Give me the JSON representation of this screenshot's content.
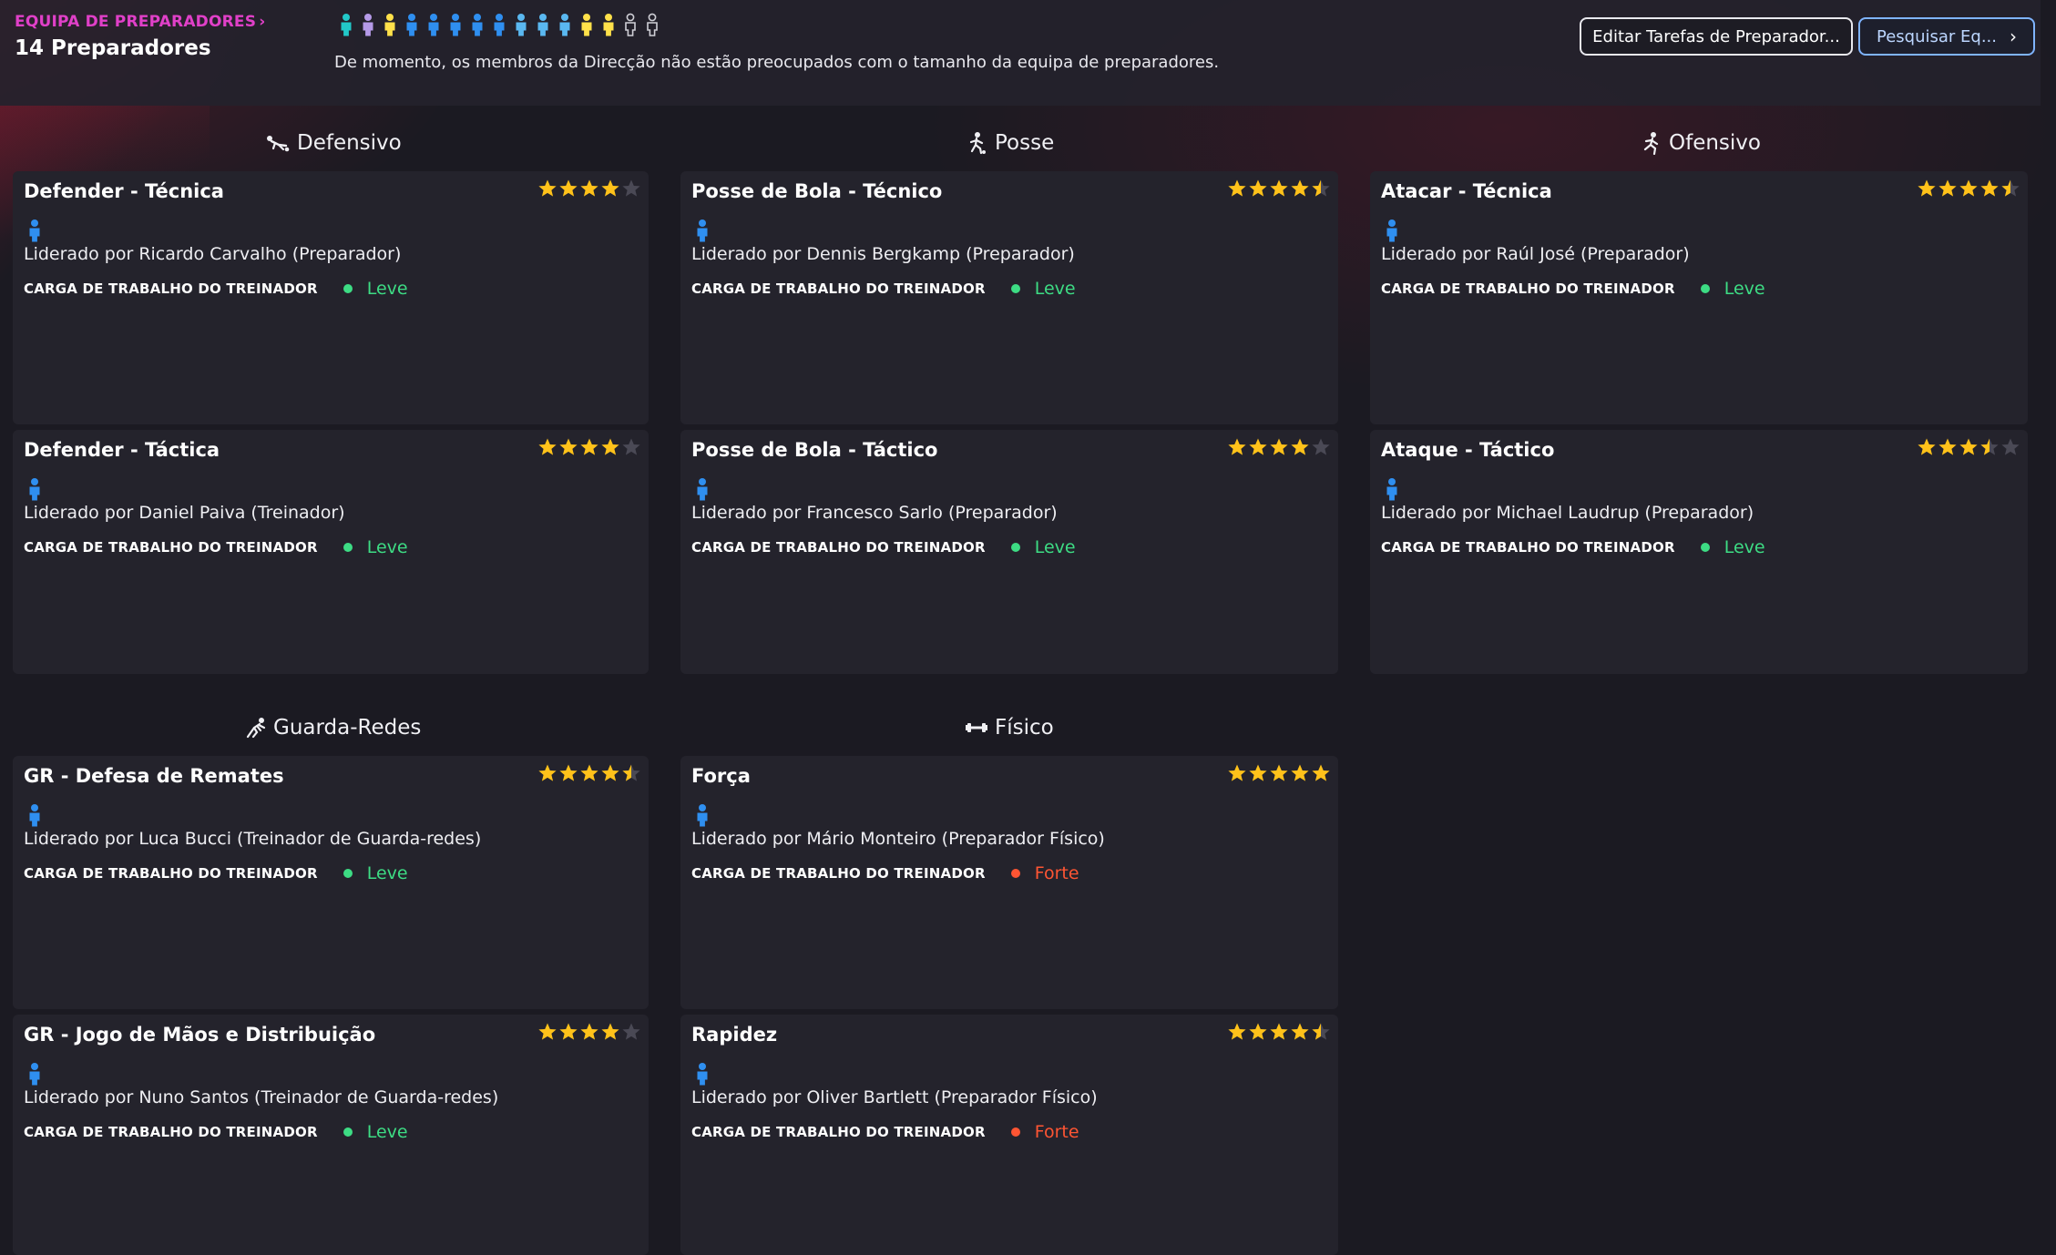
{
  "colors": {
    "accent": "#e040c8",
    "light": "#3ddc84",
    "heavy": "#ff5533",
    "star": "#ffc21a",
    "star_empty": "#4a4955",
    "person_blue": "#2f8ff0"
  },
  "header": {
    "breadcrumb": "EQUIPA DE PREPARADORES",
    "title": "14 Preparadores",
    "note": "De momento, os membros da Direcção não estão preocupados com o tamanho da equipa de preparadores.",
    "staff_icons": [
      "#22c8c8",
      "#b59ae8",
      "#ffe14a",
      "#2f8ff0",
      "#2f8ff0",
      "#2f8ff0",
      "#2f8ff0",
      "#2f8ff0",
      "#5ab8f0",
      "#5ab8f0",
      "#5ab8f0",
      "#ffe14a",
      "#ffe14a",
      "outline",
      "outline"
    ],
    "edit_button": "Editar Tarefas de Preparador...",
    "search_button": "Pesquisar Eq..."
  },
  "sections": {
    "defensivo": "Defensivo",
    "posse": "Posse",
    "ofensivo": "Ofensivo",
    "guarda_redes": "Guarda-Redes",
    "fisico": "Físico"
  },
  "workload_label": "CARGA DE TRABALHO DO TREINADOR",
  "cards": [
    {
      "title": "Defender - Técnica",
      "lead": "Liderado por Ricardo Carvalho (Preparador)",
      "workload": "Leve",
      "rating": 4
    },
    {
      "title": "Defender - Táctica",
      "lead": "Liderado por Daniel Paiva (Treinador)",
      "workload": "Leve",
      "rating": 4
    },
    {
      "title": "Posse de Bola - Técnico",
      "lead": "Liderado por Dennis Bergkamp (Preparador)",
      "workload": "Leve",
      "rating": 4.5
    },
    {
      "title": "Posse de Bola - Táctico",
      "lead": "Liderado por Francesco Sarlo (Preparador)",
      "workload": "Leve",
      "rating": 4
    },
    {
      "title": "Atacar - Técnica",
      "lead": "Liderado por Raúl José (Preparador)",
      "workload": "Leve",
      "rating": 4.5
    },
    {
      "title": "Ataque - Táctico",
      "lead": "Liderado por Michael Laudrup (Preparador)",
      "workload": "Leve",
      "rating": 3.5
    },
    {
      "title": "GR - Defesa de Remates",
      "lead": "Liderado por Luca Bucci (Treinador de Guarda-redes)",
      "workload": "Leve",
      "rating": 4.5
    },
    {
      "title": "GR - Jogo de Mãos e Distribuição",
      "lead": "Liderado por Nuno Santos (Treinador de Guarda-redes)",
      "workload": "Leve",
      "rating": 4
    },
    {
      "title": "Força",
      "lead": "Liderado por Mário Monteiro (Preparador Físico)",
      "workload": "Forte",
      "rating": 5
    },
    {
      "title": "Rapidez",
      "lead": "Liderado por Oliver Bartlett (Preparador Físico)",
      "workload": "Forte",
      "rating": 4.5
    }
  ]
}
